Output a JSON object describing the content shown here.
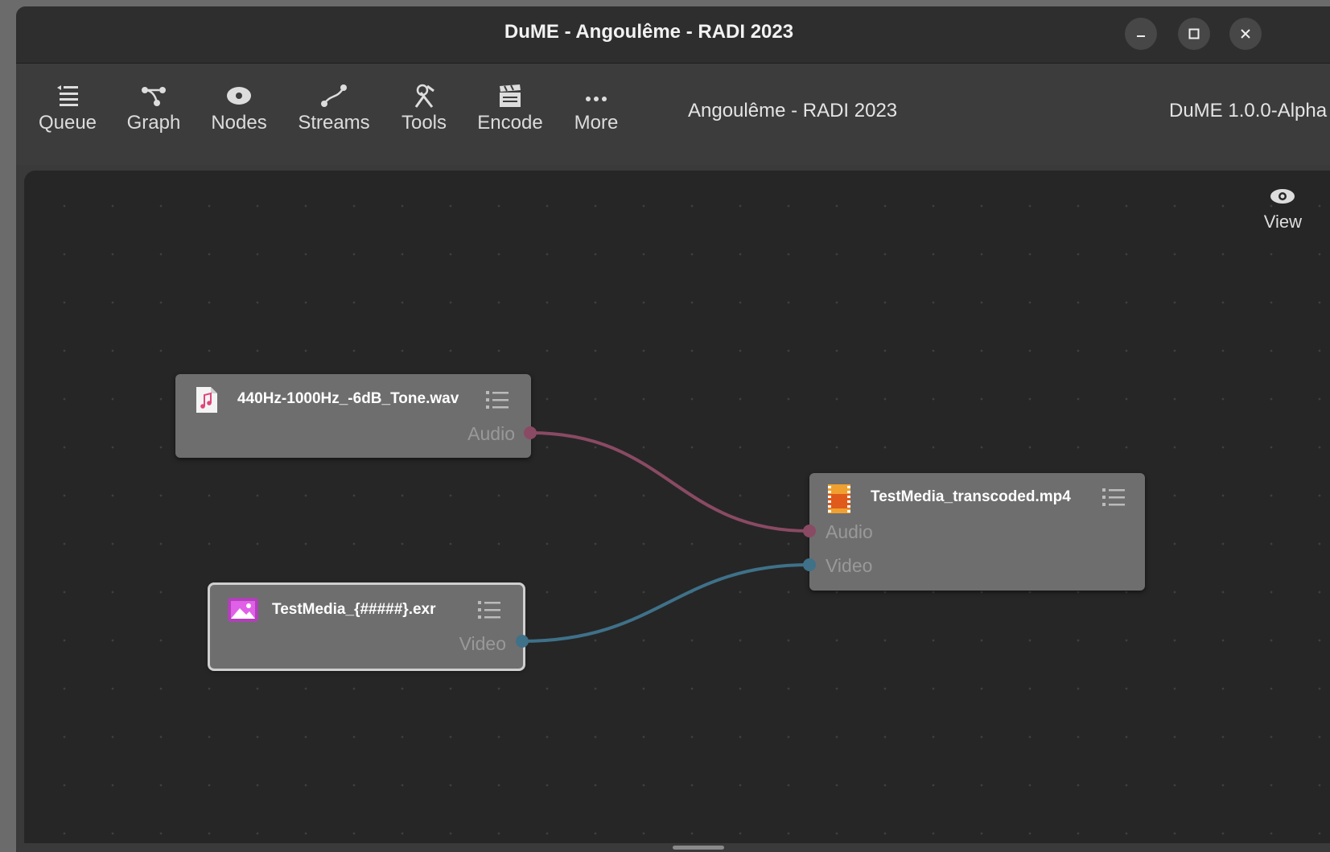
{
  "window": {
    "title": "DuME - Angoulême - RADI 2023"
  },
  "toolbar": {
    "items": [
      {
        "label": "Queue",
        "icon": "queue-icon"
      },
      {
        "label": "Graph",
        "icon": "graph-icon"
      },
      {
        "label": "Nodes",
        "icon": "nodes-icon"
      },
      {
        "label": "Streams",
        "icon": "streams-icon"
      },
      {
        "label": "Tools",
        "icon": "tools-icon"
      },
      {
        "label": "Encode",
        "icon": "encode-icon"
      },
      {
        "label": "More",
        "icon": "more-icon"
      }
    ],
    "project_name": "Angoulême - RADI 2023",
    "version": "DuME 1.0.0-Alpha"
  },
  "canvas": {
    "view_label": "View",
    "nodes": [
      {
        "id": "audio-input",
        "title": "440Hz-1000Hz_-6dB_Tone.wav",
        "icon": "audio-file-icon",
        "ports": [
          "Audio"
        ]
      },
      {
        "id": "output",
        "title": "TestMedia_transcoded.mp4",
        "icon": "video-file-icon",
        "ports": [
          "Audio",
          "Video"
        ]
      },
      {
        "id": "image-input",
        "title": "TestMedia_{#####}.exr",
        "icon": "image-file-icon",
        "ports": [
          "Video"
        ]
      }
    ],
    "connections": [
      {
        "from": "audio-input.Audio",
        "to": "output.Audio",
        "color": "#8a4a63"
      },
      {
        "from": "image-input.Video",
        "to": "output.Video",
        "color": "#3f7189"
      }
    ]
  },
  "colors": {
    "audio_port": "#8a4a63",
    "video_port": "#3f7189"
  }
}
